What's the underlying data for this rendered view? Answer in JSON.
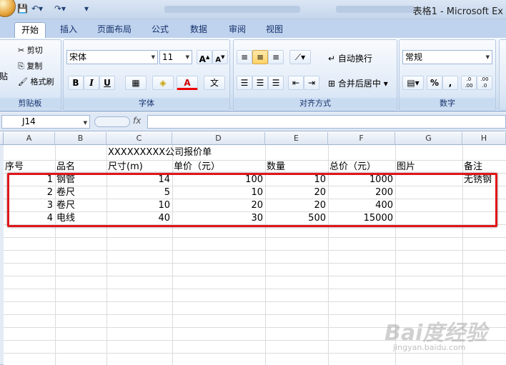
{
  "window": {
    "title": "表格1 - Microsoft Ex"
  },
  "tabs": [
    {
      "label": "开始",
      "active": true
    },
    {
      "label": "插入"
    },
    {
      "label": "页面布局"
    },
    {
      "label": "公式"
    },
    {
      "label": "数据"
    },
    {
      "label": "审阅"
    },
    {
      "label": "视图"
    }
  ],
  "clipboard": {
    "cut": "剪切",
    "copy": "复制",
    "format_painter": "格式刷",
    "paste": "贴",
    "label": "剪贴板"
  },
  "font": {
    "name": "宋体",
    "size": "11",
    "grow": "A",
    "shrink": "A",
    "bold": "B",
    "italic": "I",
    "underline": "U",
    "color_a": "A",
    "label": "字体",
    "wen": "文"
  },
  "alignment": {
    "wrap": "自动换行",
    "merge": "合并后居中",
    "label": "对齐方式"
  },
  "number": {
    "format": "常规",
    "percent": "%",
    "comma": ",",
    "inc": ".0 .00",
    "dec": ".00 .0",
    "label": "数字"
  },
  "formula_bar": {
    "cell_ref": "J14",
    "fx": "fx",
    "value": ""
  },
  "columns": [
    "A",
    "B",
    "C",
    "D",
    "E",
    "F",
    "G",
    "H"
  ],
  "sheet": {
    "title": "XXXXXXXXX公司报价单",
    "headers": [
      "序号",
      "品名",
      "尺寸(m)",
      "单价（元）",
      "数量",
      "总价（元）",
      "图片",
      "备注"
    ],
    "rows": [
      {
        "no": "1",
        "name": "钢管",
        "size": "14",
        "price": "100",
        "qty": "10",
        "total": "1000",
        "pic": "",
        "note": "无锈钢"
      },
      {
        "no": "2",
        "name": "卷尺",
        "size": "5",
        "price": "10",
        "qty": "20",
        "total": "200",
        "pic": "",
        "note": ""
      },
      {
        "no": "3",
        "name": "卷尺",
        "size": "10",
        "price": "20",
        "qty": "20",
        "total": "400",
        "pic": "",
        "note": ""
      },
      {
        "no": "4",
        "name": "电线",
        "size": "40",
        "price": "30",
        "qty": "500",
        "total": "15000",
        "pic": "",
        "note": ""
      }
    ]
  },
  "highlight": {
    "color": "#e0161a"
  },
  "watermark": {
    "main": "Bai度经验",
    "sub": "jingyan.baidu.com"
  }
}
